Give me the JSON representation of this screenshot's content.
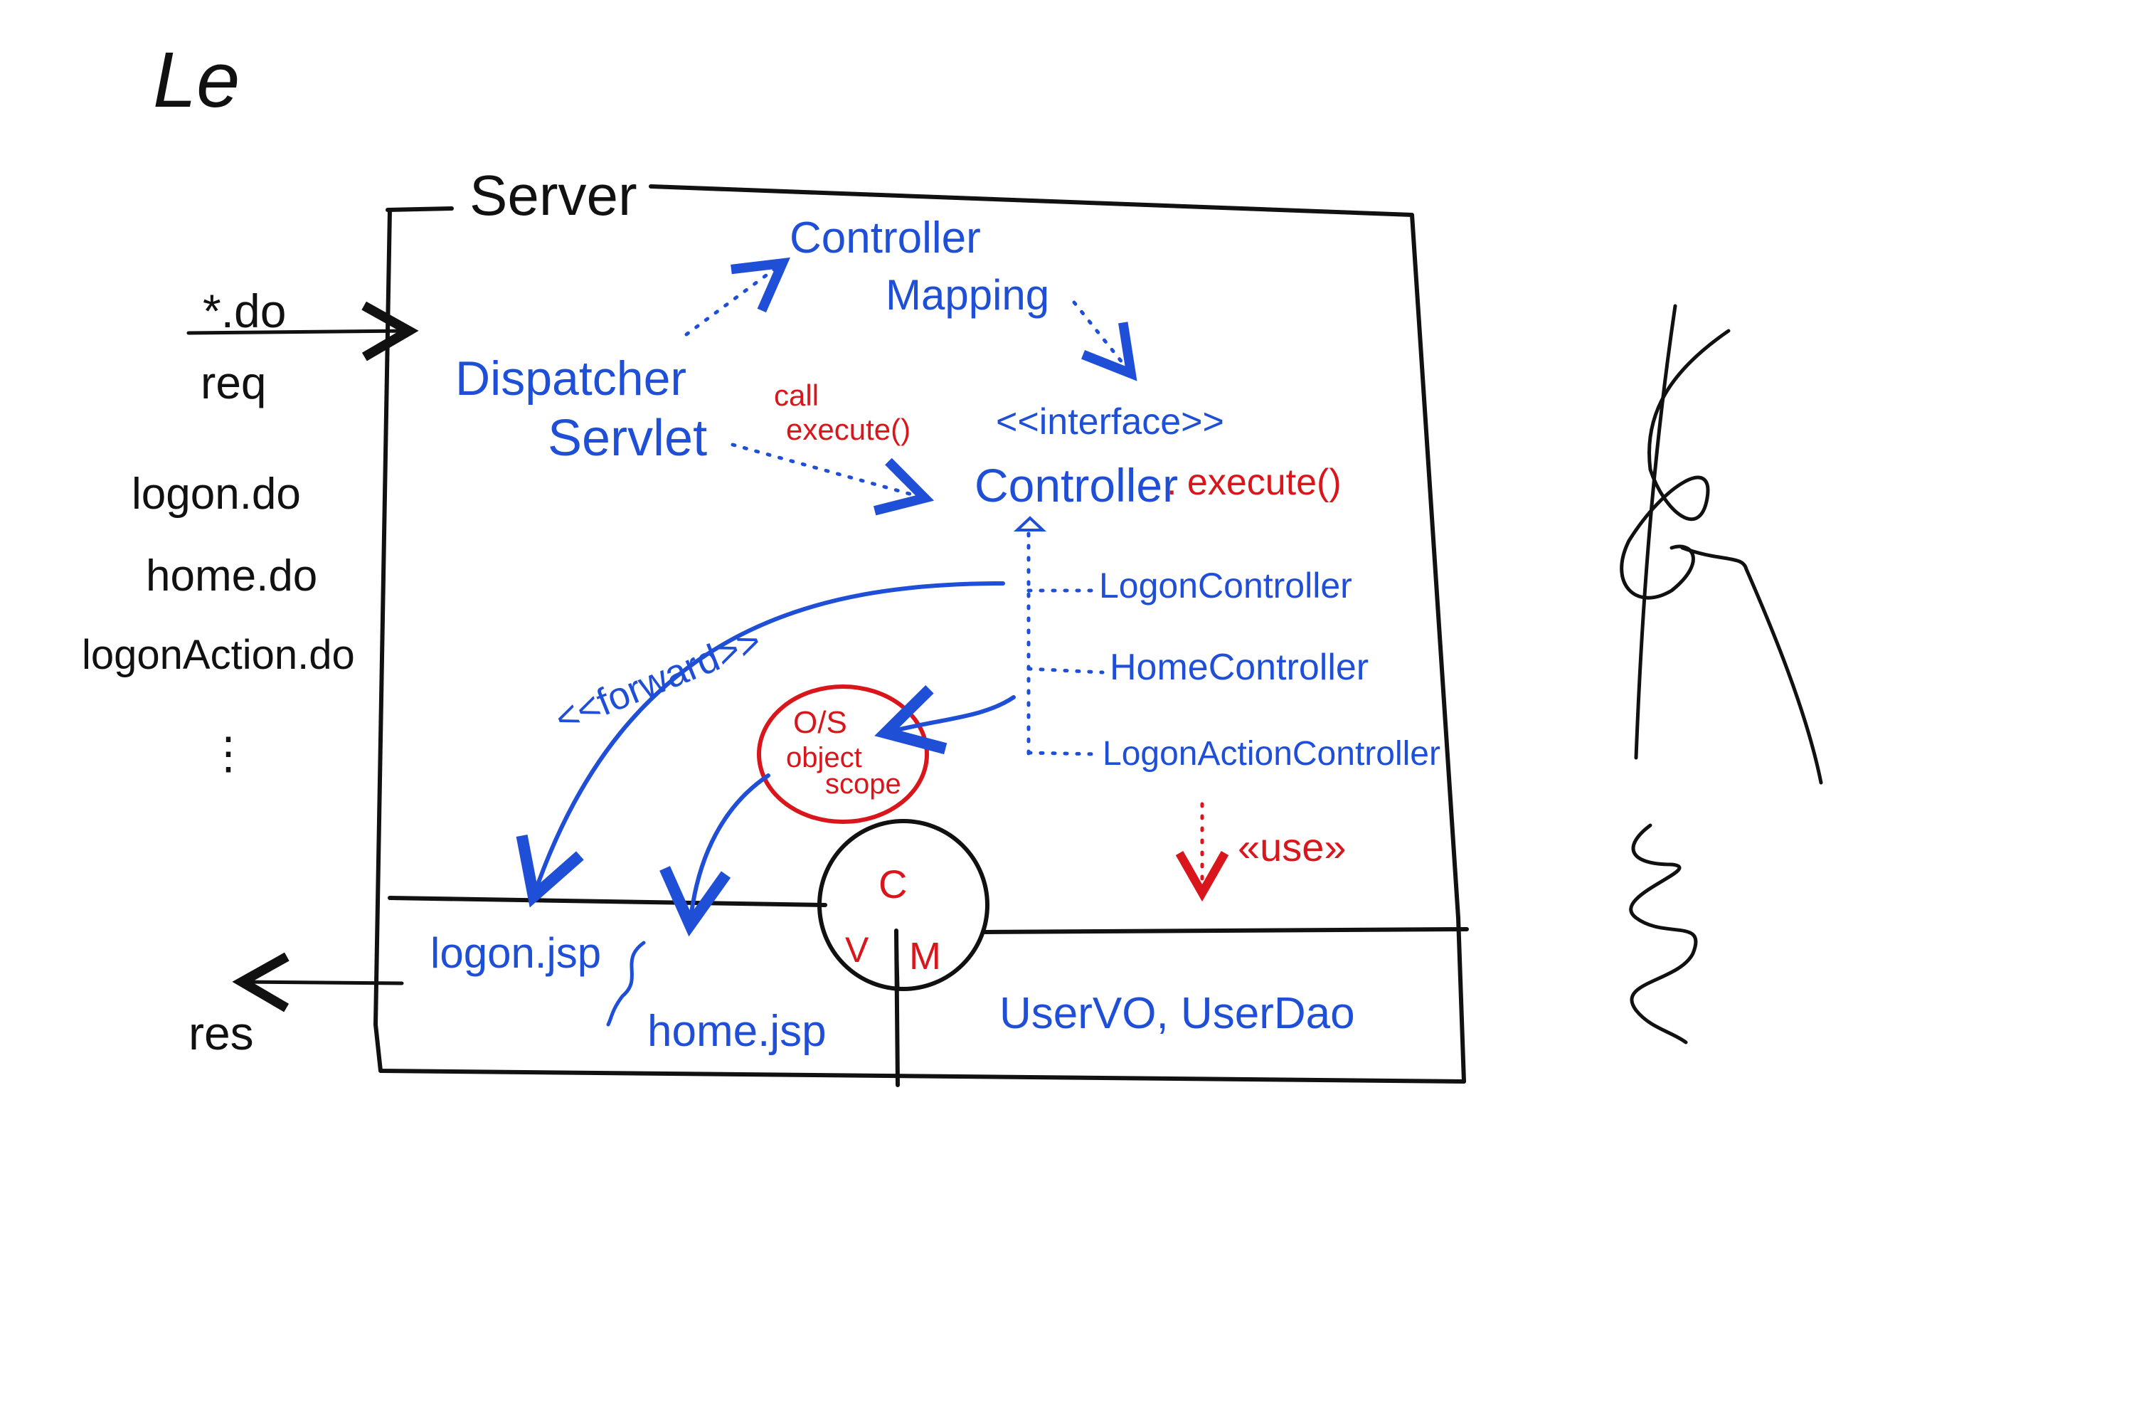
{
  "colors": {
    "black": "#111111",
    "blue": "#1f4fd6",
    "red": "#d9161b",
    "background": "#ffffff"
  },
  "header_scribble": "Le",
  "server": {
    "label": "Server"
  },
  "client": {
    "request_pattern": "*.do",
    "request_label": "req",
    "response_label": "res",
    "urls": [
      "logon.do",
      "home.do",
      "logonAction.do"
    ],
    "ellipsis": "⋮"
  },
  "dispatcher": {
    "line1": "Dispatcher",
    "line2": "Servlet"
  },
  "controller_mapping": {
    "line1": "Controller",
    "line2": "Mapping"
  },
  "call_note": {
    "line1": "call",
    "line2": "execute()"
  },
  "controller_interface": {
    "stereotype": "<<interface>>",
    "name": "Controller",
    "method": ". execute()"
  },
  "controllers": [
    "LogonController",
    "HomeController",
    "LogonActionController"
  ],
  "forward_label": "<<forward>>",
  "object_scope": {
    "line1": "O/S",
    "line2": "object",
    "line3": "scope"
  },
  "use_label": "«use»",
  "mvc": {
    "c": "C",
    "v": "V",
    "m": "M"
  },
  "views": {
    "logon": "logon.jsp",
    "home": "home.jsp"
  },
  "model": "UserVO, UserDao"
}
